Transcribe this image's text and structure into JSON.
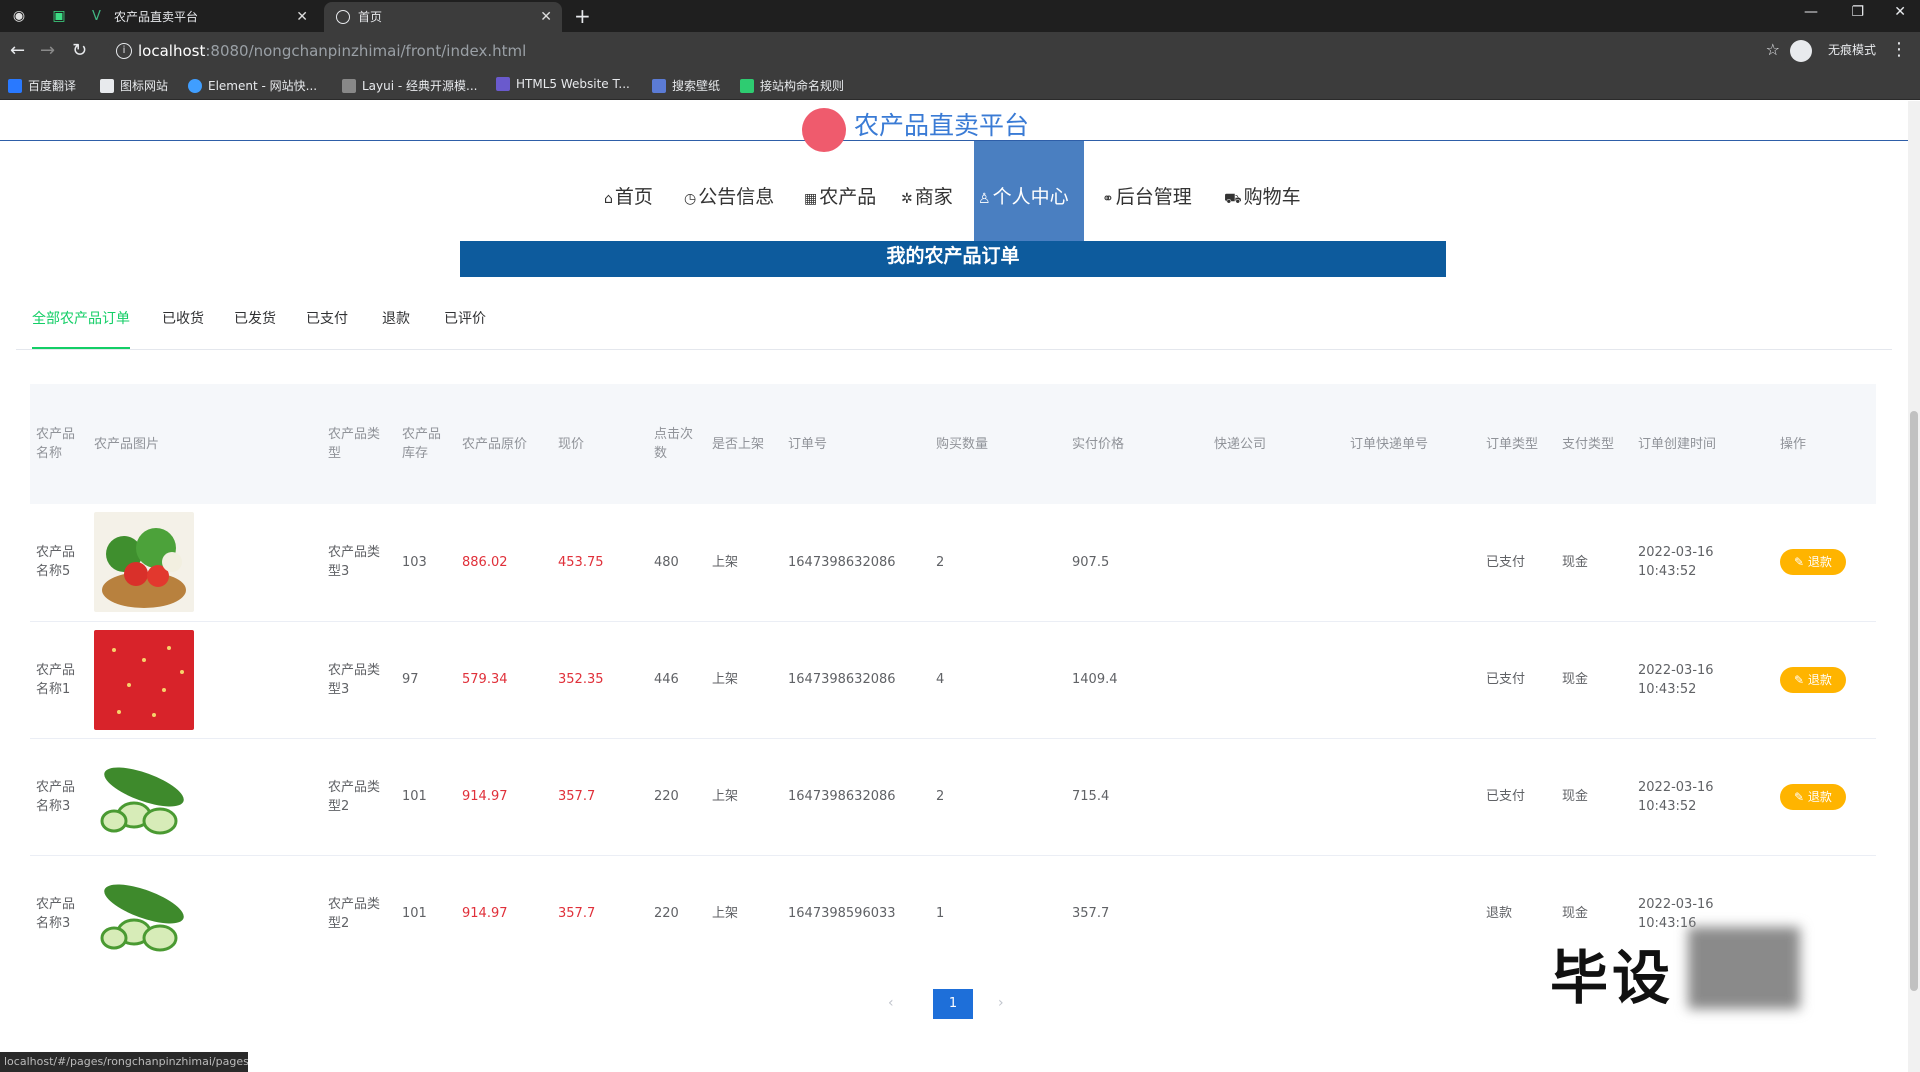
{
  "browser": {
    "tabs": [
      {
        "title": "农产品直卖平台"
      },
      {
        "title": "首页"
      }
    ],
    "new_tab": "+",
    "url_host": "localhost",
    "url_rest": ":8080/nongchanpinzhimai/front/index.html",
    "incognito_label": "无痕模式",
    "bookmarks": [
      "百度翻译",
      "图标网站",
      "Element - 网站快...",
      "Layui - 经典开源模...",
      "HTML5 Website T...",
      "搜索壁纸",
      "接站构命名规则"
    ],
    "window_controls": [
      "—",
      "❐",
      "✕"
    ]
  },
  "site": {
    "brand": "农产品直卖平台",
    "nav": [
      {
        "icon": "⌂",
        "label": "首页"
      },
      {
        "icon": "◷",
        "label": "公告信息"
      },
      {
        "icon": "▦",
        "label": "农产品"
      },
      {
        "icon": "✲",
        "label": "商家"
      },
      {
        "icon": "♙",
        "label": "个人中心"
      },
      {
        "icon": "⚭",
        "label": "后台管理"
      },
      {
        "icon": "⛟",
        "label": "购物车"
      }
    ],
    "active_nav": "个人中心",
    "banner_title": "我的农产品订单"
  },
  "subtabs": [
    "全部农产品订单",
    "已收货",
    "已发货",
    "已支付",
    "退款",
    "已评价"
  ],
  "active_subtab": "全部农产品订单",
  "table": {
    "headers": [
      "农产品名称",
      "农产品图片",
      "农产品类型",
      "农产品库存",
      "农产品原价",
      "现价",
      "点击次数",
      "是否上架",
      "订单号",
      "购买数量",
      "实付价格",
      "快递公司",
      "订单快递单号",
      "订单类型",
      "支付类型",
      "订单创建时间",
      "操作"
    ],
    "rows": [
      {
        "name": "农产品名称5",
        "image": "vegetable-basket",
        "type": "农产品类型3",
        "stock": "103",
        "orig_price": "886.02",
        "price": "453.75",
        "clicks": "480",
        "onsale": "上架",
        "order_no": "1647398632086",
        "qty": "2",
        "paid": "907.5",
        "courier": "",
        "tracking": "",
        "order_type": "已支付",
        "pay_type": "现金",
        "created": "2022-03-16 10:43:52",
        "action": "退款"
      },
      {
        "name": "农产品名称1",
        "image": "strawberry",
        "type": "农产品类型3",
        "stock": "97",
        "orig_price": "579.34",
        "price": "352.35",
        "clicks": "446",
        "onsale": "上架",
        "order_no": "1647398632086",
        "qty": "4",
        "paid": "1409.4",
        "courier": "",
        "tracking": "",
        "order_type": "已支付",
        "pay_type": "现金",
        "created": "2022-03-16 10:43:52",
        "action": "退款"
      },
      {
        "name": "农产品名称3",
        "image": "cucumber",
        "type": "农产品类型2",
        "stock": "101",
        "orig_price": "914.97",
        "price": "357.7",
        "clicks": "220",
        "onsale": "上架",
        "order_no": "1647398632086",
        "qty": "2",
        "paid": "715.4",
        "courier": "",
        "tracking": "",
        "order_type": "已支付",
        "pay_type": "现金",
        "created": "2022-03-16 10:43:52",
        "action": "退款"
      },
      {
        "name": "农产品名称3",
        "image": "cucumber",
        "type": "农产品类型2",
        "stock": "101",
        "orig_price": "914.97",
        "price": "357.7",
        "clicks": "220",
        "onsale": "上架",
        "order_no": "1647398596033",
        "qty": "1",
        "paid": "357.7",
        "courier": "",
        "tracking": "",
        "order_type": "退款",
        "pay_type": "现金",
        "created": "2022-03-16 10:43:16",
        "action": ""
      }
    ]
  },
  "pagination": {
    "prev": "‹",
    "current": "1",
    "next": "›"
  },
  "watermark": "毕设",
  "status_url": "localhost/#/pages/rongchanpinzhimai/pages...",
  "colors": {
    "accent": "#13ce66",
    "nav_active": "#4a7fc1",
    "banner": "#0d5b9d",
    "action": "#ffb400",
    "price": "#e0303a"
  }
}
